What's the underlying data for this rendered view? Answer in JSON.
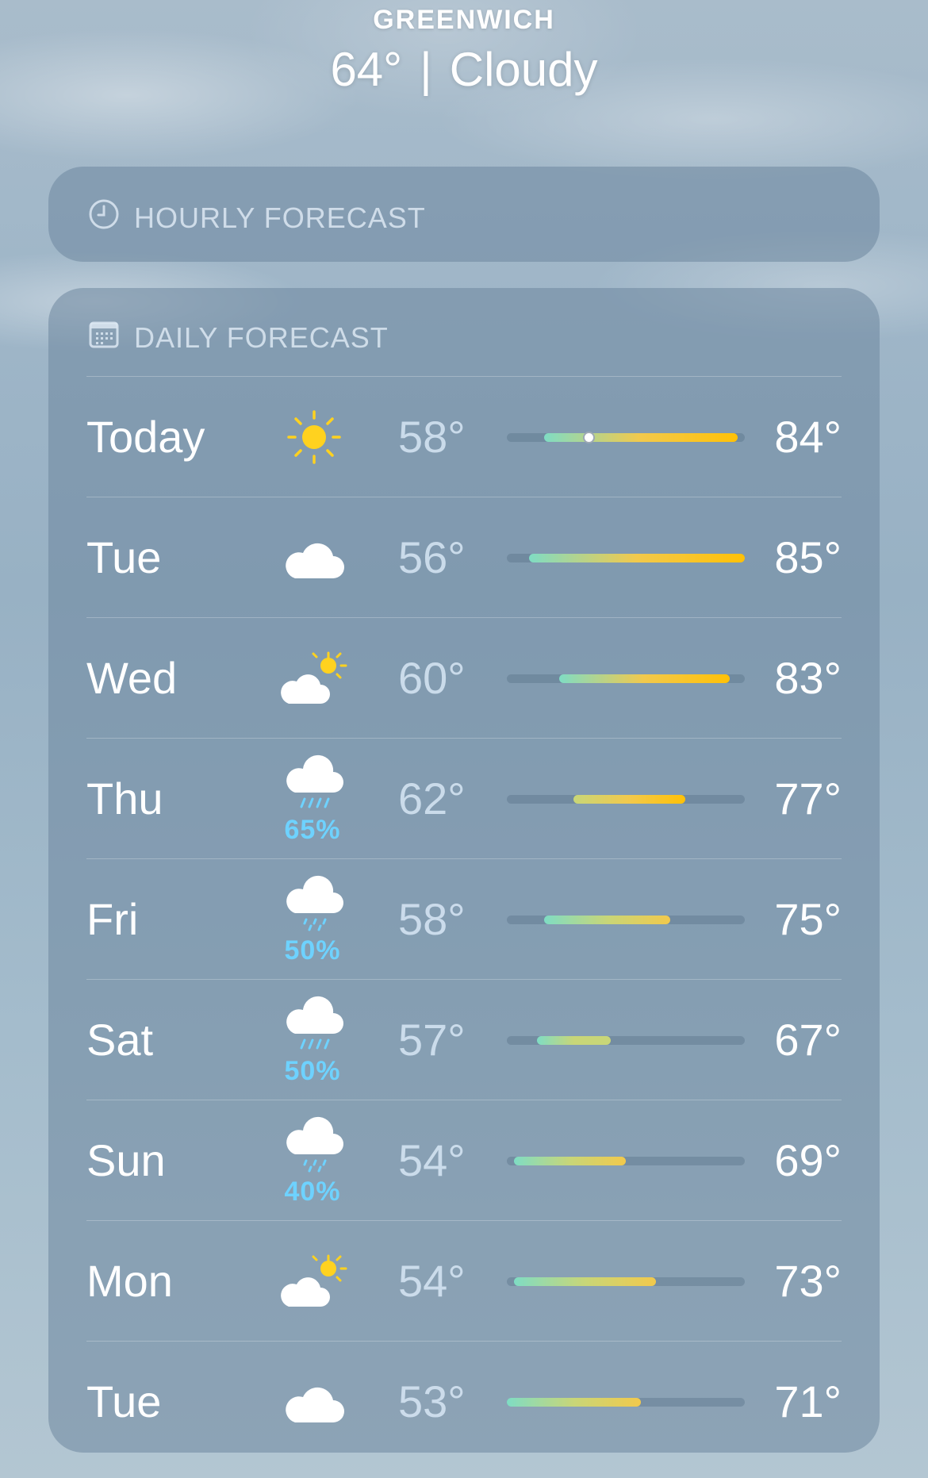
{
  "location": {
    "city": "GREENWICH",
    "temperature": "64°",
    "separator": "|",
    "condition": "Cloudy"
  },
  "hourly": {
    "title": "HOURLY FORECAST",
    "icon": "clock-icon"
  },
  "daily": {
    "title": "DAILY FORECAST",
    "icon": "calendar-icon",
    "range": {
      "min": 53,
      "max": 85
    },
    "days": [
      {
        "day": "Today",
        "icon": "sun",
        "precip": "",
        "low": "58°",
        "high": "84°",
        "low_value": 58,
        "high_value": 84,
        "current_value": 64
      },
      {
        "day": "Tue",
        "icon": "cloud",
        "precip": "",
        "low": "56°",
        "high": "85°",
        "low_value": 56,
        "high_value": 85
      },
      {
        "day": "Wed",
        "icon": "cloud-sun",
        "precip": "",
        "low": "60°",
        "high": "83°",
        "low_value": 60,
        "high_value": 83
      },
      {
        "day": "Thu",
        "icon": "cloud-rain",
        "precip": "65%",
        "low": "62°",
        "high": "77°",
        "low_value": 62,
        "high_value": 77
      },
      {
        "day": "Fri",
        "icon": "cloud-drizzle",
        "precip": "50%",
        "low": "58°",
        "high": "75°",
        "low_value": 58,
        "high_value": 75
      },
      {
        "day": "Sat",
        "icon": "cloud-rain",
        "precip": "50%",
        "low": "57°",
        "high": "67°",
        "low_value": 57,
        "high_value": 67
      },
      {
        "day": "Sun",
        "icon": "cloud-drizzle",
        "precip": "40%",
        "low": "54°",
        "high": "69°",
        "low_value": 54,
        "high_value": 69
      },
      {
        "day": "Mon",
        "icon": "cloud-sun",
        "precip": "",
        "low": "54°",
        "high": "73°",
        "low_value": 54,
        "high_value": 73
      },
      {
        "day": "Tue",
        "icon": "cloud",
        "precip": "",
        "low": "53°",
        "high": "71°",
        "low_value": 53,
        "high_value": 71
      }
    ]
  }
}
